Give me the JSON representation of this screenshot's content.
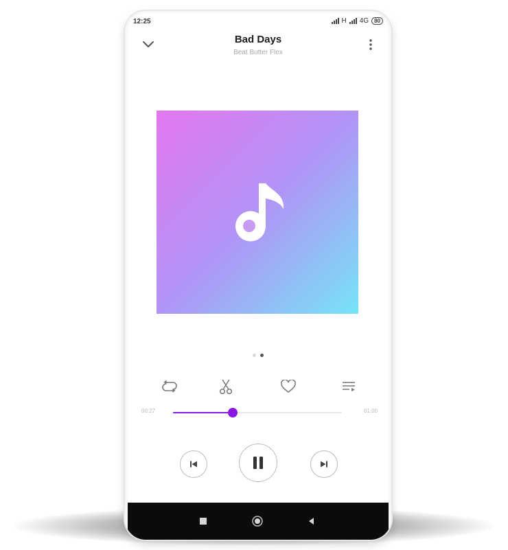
{
  "status_bar": {
    "time": "12:25",
    "network_label": "H",
    "network_type": "4G",
    "battery": "80"
  },
  "header": {
    "title": "Bad Days",
    "artist": "Beat Butter Flex",
    "collapse_icon": "chevron-down-icon",
    "menu_icon": "more-vertical-icon"
  },
  "album_art": {
    "icon": "music-note-icon",
    "gradient": [
      "#e477ef",
      "#b194f6",
      "#76e4f6"
    ]
  },
  "pager": {
    "pages": 2,
    "active_index": 1
  },
  "actions": [
    {
      "name": "repeat",
      "icon": "repeat-icon"
    },
    {
      "name": "trim",
      "icon": "scissors-icon"
    },
    {
      "name": "favorite",
      "icon": "heart-icon"
    },
    {
      "name": "queue",
      "icon": "playlist-icon"
    }
  ],
  "progress": {
    "elapsed": "00:27",
    "total": "01:00",
    "fraction": 0.355,
    "accent": "#8a18e0"
  },
  "controls": {
    "previous_icon": "skip-previous-icon",
    "play_pause_icon": "pause-icon",
    "next_icon": "skip-next-icon"
  },
  "nav_bar": {
    "recent_icon": "square-icon",
    "home_icon": "circle-icon",
    "back_icon": "triangle-back-icon"
  }
}
